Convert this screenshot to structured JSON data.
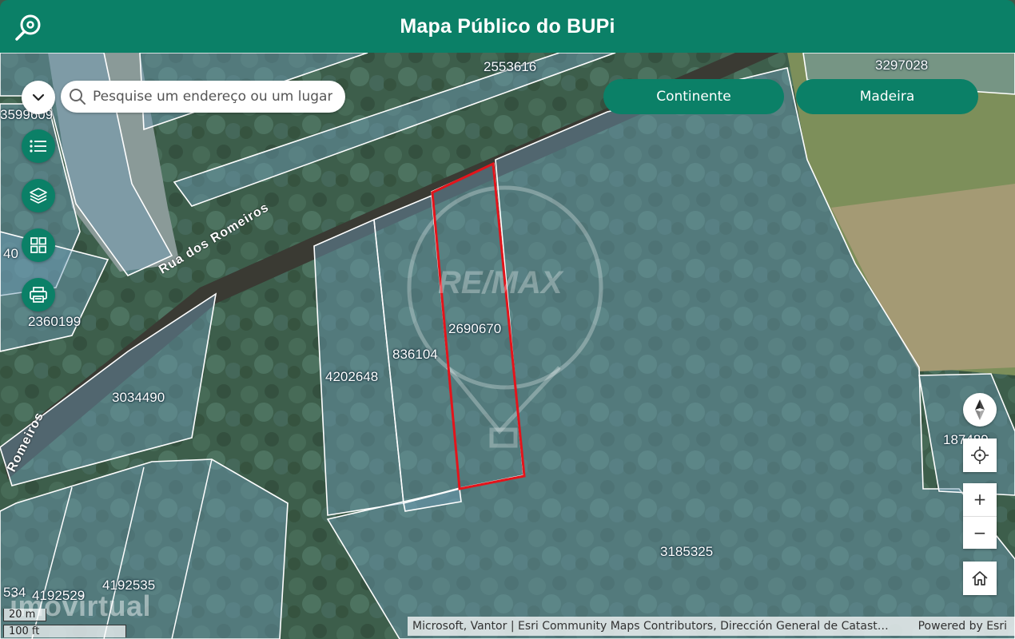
{
  "header": {
    "title": "Mapa Público do BUPi"
  },
  "search": {
    "placeholder": "Pesquise um endereço ou um lugar"
  },
  "region_buttons": {
    "continente": "Continente",
    "madeira": "Madeira"
  },
  "zoom": {
    "in_label": "+",
    "out_label": "−"
  },
  "parcels": [
    {
      "id": "2553616"
    },
    {
      "id": "3297028"
    },
    {
      "id": "3599609"
    },
    {
      "id": "40"
    },
    {
      "id": "2360199"
    },
    {
      "id": "3034490"
    },
    {
      "id": "4202648"
    },
    {
      "id": "836104"
    },
    {
      "id": "2690670"
    },
    {
      "id": "3185325"
    },
    {
      "id": "187489"
    },
    {
      "id": "4192535"
    },
    {
      "id": "4192529"
    },
    {
      "id": "534"
    }
  ],
  "roads": [
    {
      "name": "Rua dos Romeiros"
    },
    {
      "name": "Romeiros"
    }
  ],
  "watermark": {
    "text": "imovirtual",
    "center_logo": "RE/MAX"
  },
  "scale": {
    "metric": "20 m",
    "imperial": "100 ft"
  },
  "attribution": {
    "text": "Microsoft, Vantor | Esri Community Maps Contributors, Dirección General de Catast…",
    "powered": "Powered by Esri"
  },
  "colors": {
    "brand": "#0b8067",
    "selected_parcel": "#e3141b",
    "parcel_fill": "#6e9db8"
  }
}
